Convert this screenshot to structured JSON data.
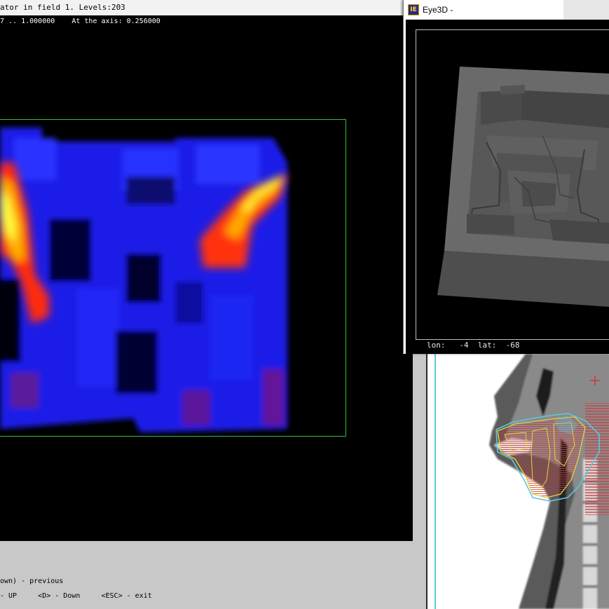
{
  "main_window": {
    "title": "ator in field 1. Levels:203",
    "info_line": "7 .. 1.000000    At the axis: 0.256000"
  },
  "bottom_help": {
    "line1": "own) - previous",
    "line2": "- UP     <D> - Down     <ESC> - exit"
  },
  "eye3d": {
    "title": "Eye3D -",
    "icon": "eye3d-app-icon",
    "status": "lon:   -4  lat:  -68"
  },
  "colors": {
    "heatmap_low": "#0a14ff",
    "heatmap_high": "#ffff30",
    "field_outline": "#2fbf3a",
    "contour_yellow": "#e8d23a",
    "contour_cyan": "#5cc8e0",
    "marker_red": "#d83030"
  }
}
